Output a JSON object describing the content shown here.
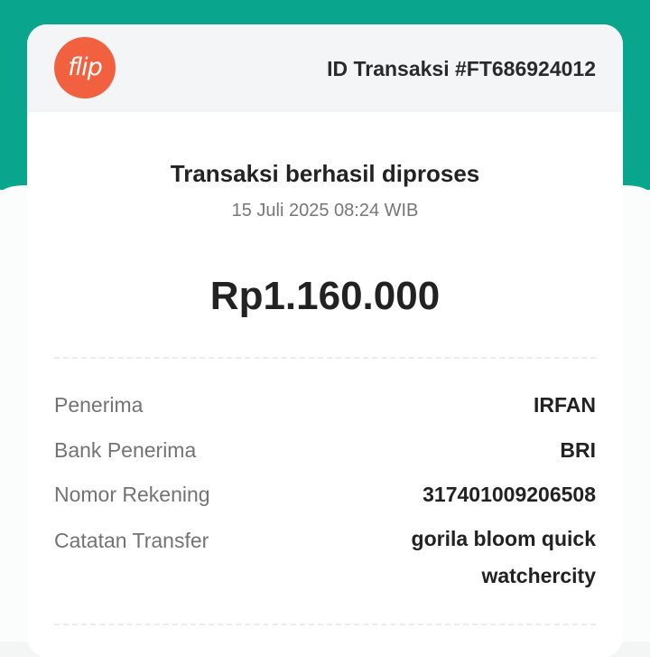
{
  "brand": {
    "logo_text": "flip",
    "logo_color": "#f2613f",
    "accent_color": "#0aa58d"
  },
  "transaction": {
    "id_label": "ID Transaksi #FT686924012",
    "status_title": "Transaksi berhasil diproses",
    "date_time": "15 Juli 2025 08:24 WIB",
    "amount": "Rp1.160.000"
  },
  "details": [
    {
      "label": "Penerima",
      "value": "IRFAN"
    },
    {
      "label": "Bank Penerima",
      "value": "BRI"
    },
    {
      "label": "Nomor Rekening",
      "value": "317401009206508"
    },
    {
      "label": "Catatan Transfer",
      "value": "gorila bloom quick watchercity"
    }
  ]
}
